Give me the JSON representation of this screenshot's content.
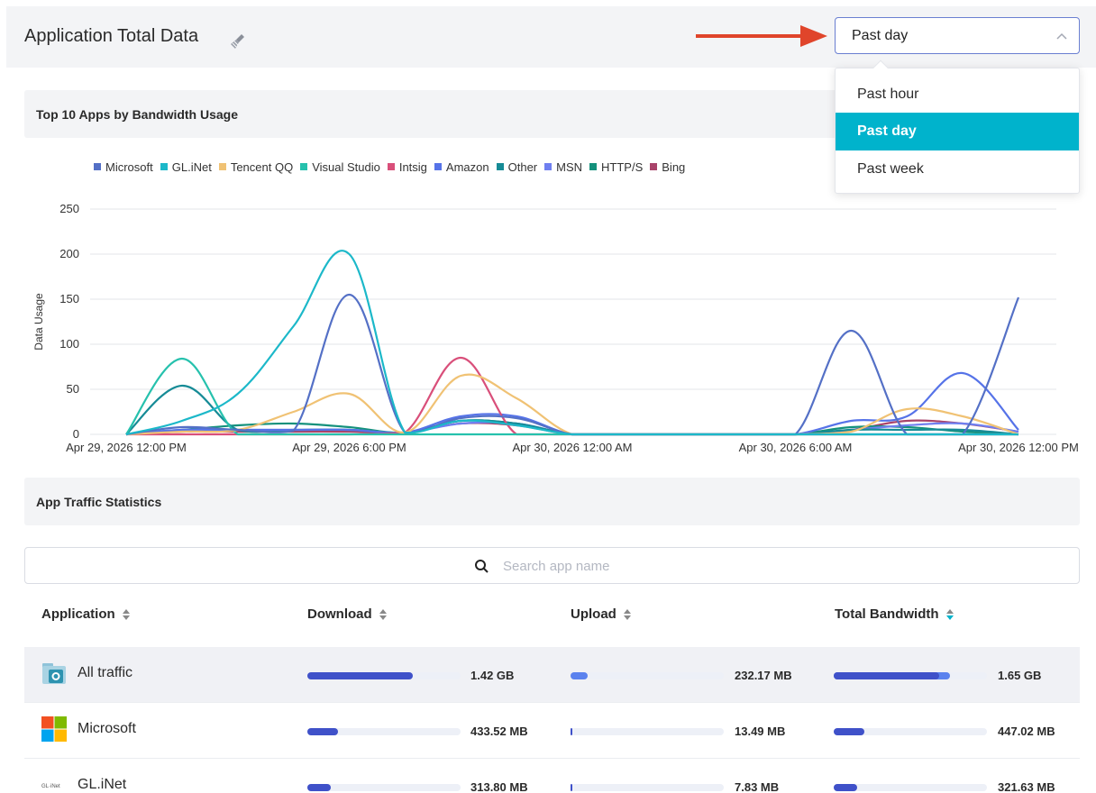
{
  "header": {
    "title": "Application Total Data",
    "icon": "broom-icon"
  },
  "time_range": {
    "selected": "Past day",
    "options": [
      "Past hour",
      "Past day",
      "Past week"
    ],
    "active_index": 1
  },
  "chart_section": {
    "title": "Top 10 Apps by Bandwidth Usage"
  },
  "colors": {
    "accent": "#00b3cc",
    "bar_dark": "#3f51c9",
    "bar_light": "#5b82ee",
    "annotation_arrow": "#e0452b"
  },
  "chart_data": {
    "type": "line",
    "ylabel": "Data Usage",
    "ylim": [
      0,
      250
    ],
    "yticks": [
      "0",
      "50",
      "100",
      "150",
      "200",
      "250"
    ],
    "x_tick_labels": [
      "Apr 29, 2026 12:00 PM",
      "Apr 29, 2026 6:00 PM",
      "Apr 30, 2026 12:00 AM",
      "Apr 30, 2026 6:00 AM",
      "Apr 30, 2026 12:00 PM"
    ],
    "x_hours": [
      0,
      1.5,
      3,
      4.5,
      6,
      7.5,
      9,
      10.5,
      12,
      13.5,
      15,
      16.5,
      18,
      19.5,
      21,
      22.5,
      24
    ],
    "grid": true,
    "legend_position": "top",
    "series": [
      {
        "name": "Microsoft",
        "color": "#5470c6",
        "values": [
          0,
          8,
          5,
          4,
          155,
          2,
          18,
          18,
          0,
          0,
          0,
          0,
          0,
          115,
          0,
          0,
          152
        ]
      },
      {
        "name": "GL.iNet",
        "color": "#1cb8c9",
        "values": [
          0,
          15,
          45,
          120,
          200,
          2,
          15,
          10,
          0,
          0,
          0,
          0,
          0,
          0,
          0,
          0,
          0
        ]
      },
      {
        "name": "Tencent QQ",
        "color": "#f0c274",
        "values": [
          0,
          3,
          5,
          25,
          45,
          2,
          65,
          40,
          0,
          0,
          0,
          0,
          0,
          3,
          28,
          20,
          0
        ]
      },
      {
        "name": "Visual Studio",
        "color": "#26c1ad",
        "values": [
          0,
          84,
          0,
          0,
          0,
          0,
          0,
          0,
          0,
          0,
          0,
          0,
          0,
          0,
          0,
          0,
          0
        ]
      },
      {
        "name": "Intsig",
        "color": "#d94f7a",
        "values": [
          0,
          0,
          0,
          0,
          0,
          2,
          85,
          0,
          0,
          0,
          0,
          0,
          0,
          0,
          0,
          0,
          0
        ]
      },
      {
        "name": "Amazon",
        "color": "#5673e8",
        "values": [
          0,
          5,
          5,
          5,
          5,
          2,
          20,
          20,
          0,
          0,
          0,
          0,
          0,
          15,
          20,
          68,
          5
        ]
      },
      {
        "name": "Other",
        "color": "#168b96",
        "values": [
          0,
          54,
          5,
          5,
          5,
          2,
          15,
          12,
          0,
          0,
          0,
          0,
          0,
          5,
          5,
          5,
          0
        ]
      },
      {
        "name": "MSN",
        "color": "#6f7ff0",
        "values": [
          0,
          5,
          5,
          5,
          5,
          2,
          12,
          12,
          0,
          0,
          0,
          0,
          0,
          5,
          10,
          12,
          3
        ]
      },
      {
        "name": "HTTP/S",
        "color": "#14917c",
        "values": [
          0,
          5,
          10,
          12,
          8,
          2,
          15,
          12,
          0,
          0,
          0,
          0,
          0,
          8,
          8,
          3,
          0
        ]
      },
      {
        "name": "Bing",
        "color": "#a9436a",
        "values": [
          0,
          3,
          3,
          3,
          3,
          2,
          12,
          10,
          0,
          0,
          0,
          0,
          0,
          5,
          15,
          12,
          3
        ]
      }
    ]
  },
  "stats_section": {
    "title": "App Traffic Statistics"
  },
  "search": {
    "placeholder": "Search app name",
    "value": ""
  },
  "table": {
    "columns": [
      "Application",
      "Download",
      "Upload",
      "Total Bandwidth"
    ],
    "active_sort_column": 3,
    "rows": [
      {
        "name": "All traffic",
        "icon": "folder-traffic-icon",
        "download": "1.42 GB",
        "download_pct": 69,
        "upload": "232.17 MB",
        "upload_pct": 11,
        "total": "1.65 GB",
        "total_pct": 76
      },
      {
        "name": "Microsoft",
        "icon": "microsoft-logo-icon",
        "download": "433.52 MB",
        "download_pct": 20,
        "upload": "13.49 MB",
        "upload_pct": 1,
        "total": "447.02 MB",
        "total_pct": 20
      },
      {
        "name": "GL.iNet",
        "icon": "glinet-logo-icon",
        "download": "313.80 MB",
        "download_pct": 15,
        "upload": "7.83 MB",
        "upload_pct": 1,
        "total": "321.63 MB",
        "total_pct": 15
      }
    ]
  }
}
